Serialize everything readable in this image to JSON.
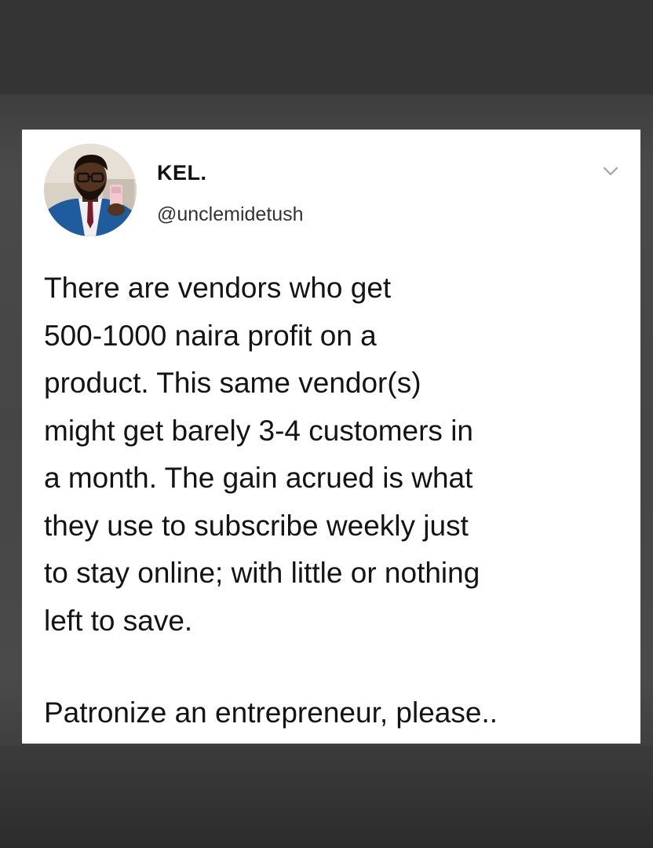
{
  "tweet": {
    "author": {
      "display_name": "KEL.",
      "handle": "@unclemidetush",
      "avatar_icon": "profile-photo"
    },
    "menu_icon": "chevron-down-icon",
    "body": "There are vendors who get\n500-1000 naira profit on a\nproduct. This same vendor(s)\nmight get barely 3-4 customers in\na month. The gain acrued is what\nthey use to subscribe weekly just\nto stay online; with little or nothing\nleft to save.",
    "closing_line": "Patronize an entrepreneur, please..",
    "colors": {
      "card_background": "#ffffff",
      "text": "#141414",
      "handle_text": "#333333",
      "chevron": "#9aa5b1",
      "page_background": "#454545"
    }
  }
}
